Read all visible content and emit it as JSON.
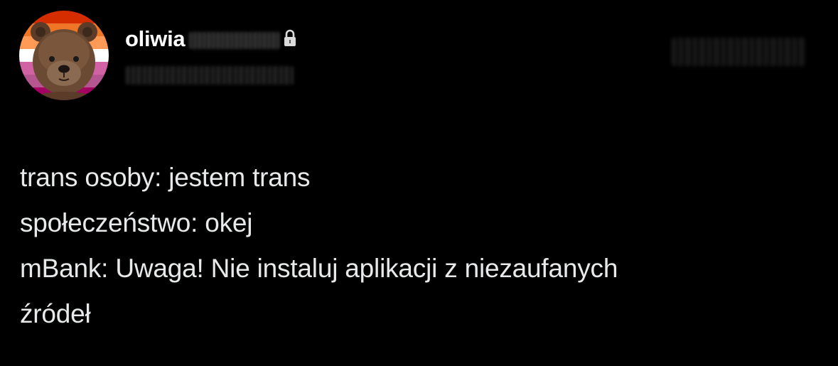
{
  "tweet": {
    "author": {
      "display_name": "oliwia",
      "account_type": "private",
      "lock_icon": "lock-icon",
      "avatar_icon": "teddy-bear-avatar"
    },
    "lines": [
      "trans osoby: jestem trans",
      "społeczeństwo: okej",
      "mBank: Uwaga! Nie instaluj aplikacji z niezaufanych",
      "źródeł"
    ]
  },
  "colors": {
    "background": "#000000",
    "text": "#e7e9ea",
    "name": "#ffffff",
    "flag_stripes": [
      "#d52d00",
      "#ef7627",
      "#ff9a56",
      "#ffffff",
      "#d162a4",
      "#b55690",
      "#a30262"
    ]
  }
}
